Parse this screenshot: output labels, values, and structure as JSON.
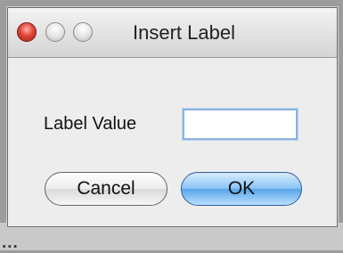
{
  "dialog": {
    "title": "Insert Label",
    "field_label": "Label Value",
    "field_value": "",
    "cancel_label": "Cancel",
    "ok_label": "OK"
  },
  "background": {
    "text": "..."
  },
  "colors": {
    "close_button": "#d8382e",
    "ok_button": "#5aa5ea",
    "input_focus": "#8fb4de"
  }
}
